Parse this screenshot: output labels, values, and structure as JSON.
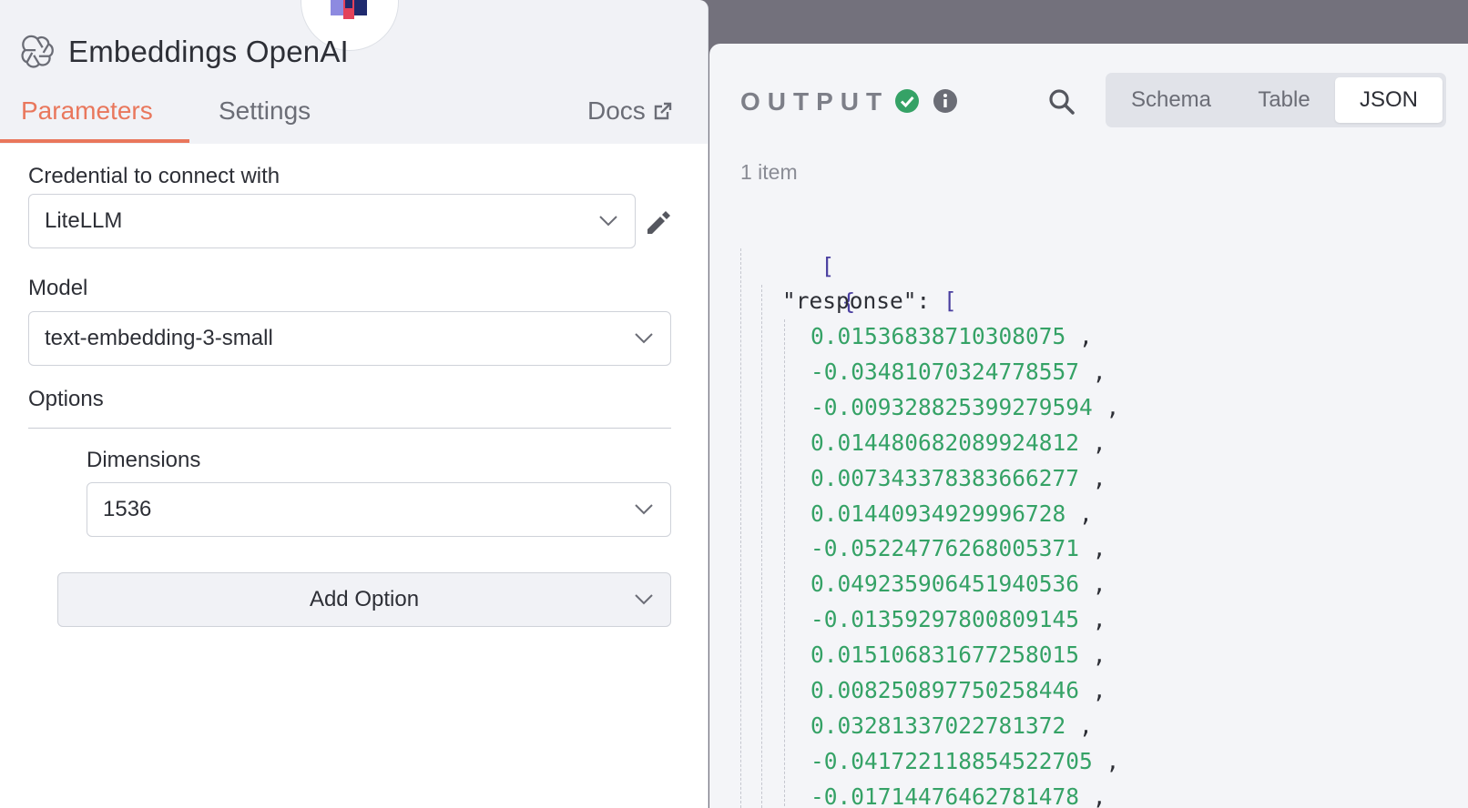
{
  "node": {
    "title": "Embeddings OpenAI",
    "tabs": {
      "parameters": "Parameters",
      "settings": "Settings"
    },
    "docs_label": "Docs",
    "accent_color": "#e9775c"
  },
  "parameters": {
    "credential": {
      "label": "Credential to connect with",
      "value": "LiteLLM"
    },
    "model": {
      "label": "Model",
      "value": "text-embedding-3-small"
    },
    "options": {
      "label": "Options",
      "dimensions": {
        "label": "Dimensions",
        "value": "1536"
      },
      "add_option_label": "Add Option"
    }
  },
  "output": {
    "label": "OUTPUT",
    "status": "success",
    "status_color": "#35a266",
    "views": [
      "Schema",
      "Table",
      "JSON"
    ],
    "active_view": "JSON",
    "item_count": "1 item",
    "json": {
      "open_array": "[",
      "open_object": "{",
      "key": "\"response\"",
      "key_open": "[",
      "values": [
        "0.01536838710308075",
        "-0.03481070324778557",
        "-0.009328825399279594",
        "0.014480682089924812",
        "0.007343378383666277",
        "0.01440934929996728",
        "-0.05224776268005371",
        "0.049235906451940536",
        "-0.01359297800809145",
        "0.015106831677258015",
        "0.008250897750258446",
        "0.03281337022781372",
        "-0.041722118854522705",
        "-0.01714476462781478"
      ]
    }
  }
}
